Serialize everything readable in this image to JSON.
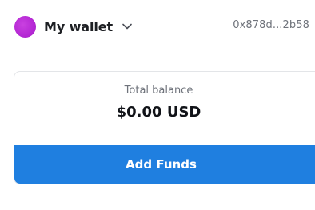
{
  "header": {
    "wallet_name": "My wallet",
    "address": "0x878d...2b58",
    "avatar_color": "#c234d8"
  },
  "balance_card": {
    "label": "Total balance",
    "amount": "$0.00 USD",
    "button_label": "Add Funds",
    "button_color": "#1f7fe0"
  }
}
